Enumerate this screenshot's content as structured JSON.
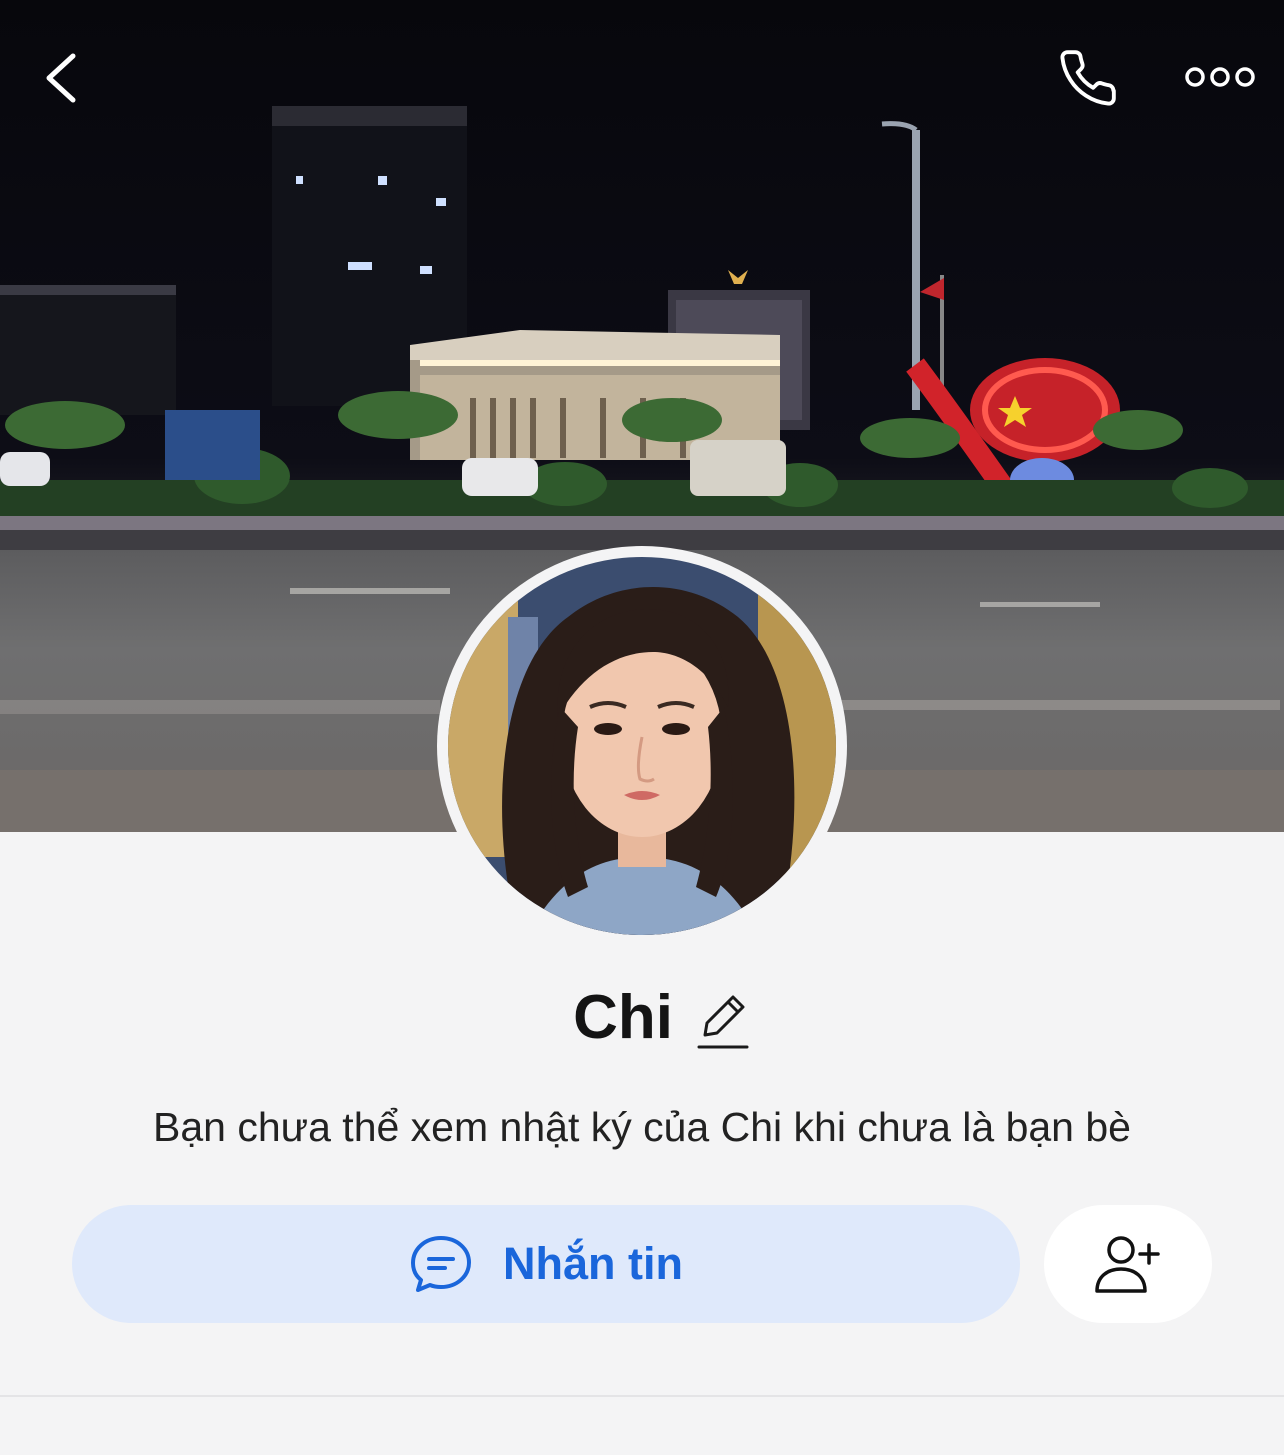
{
  "header": {
    "back_icon": "chevron-left-icon",
    "call_icon": "phone-icon",
    "more_icon": "more-horizontal-icon"
  },
  "profile": {
    "name": "Chi",
    "edit_icon": "pencil-icon",
    "notice": "Bạn chưa thể xem nhật ký của Chi khi chưa là bạn bè"
  },
  "actions": {
    "message_label": "Nhắn tin",
    "message_icon": "chat-bubble-icon",
    "add_friend_icon": "add-friend-icon"
  },
  "colors": {
    "accent": "#1a66db",
    "message_button_bg": "#dfe9fb",
    "page_bg": "#f4f4f5"
  }
}
